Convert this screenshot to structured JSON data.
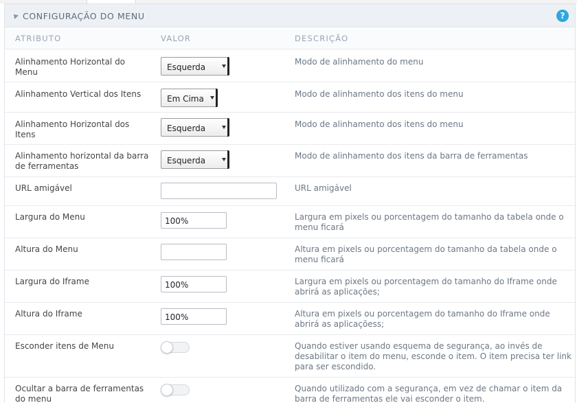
{
  "panel": {
    "title": "CONFIGURAÇÃO DO MENU",
    "help_label": "?"
  },
  "columns": {
    "attribute": "ATRIBUTO",
    "value": "VALOR",
    "description": "DESCRIÇÃO"
  },
  "rows": [
    {
      "attribute": "Alinhamento Horizontal do Menu",
      "value": "Esquerda",
      "description": "Modo de alinhamento do menu"
    },
    {
      "attribute": "Alinhamento Vertical dos Itens",
      "value": "Em Cima",
      "description": "Modo de alinhamento dos itens do menu"
    },
    {
      "attribute": "Alinhamento Horizontal dos Itens",
      "value": "Esquerda",
      "description": "Modo de alinhamento dos itens do menu"
    },
    {
      "attribute": "Alinhamento horizontal da barra de ferramentas",
      "value": "Esquerda",
      "description": "Modo de alinhamento dos itens da barra de ferramentas"
    },
    {
      "attribute": "URL amigável",
      "value": "",
      "description": "URL amigável"
    },
    {
      "attribute": "Largura do Menu",
      "value": "100%",
      "description": "Largura em pixels ou porcentagem do tamanho da tabela onde o menu ficará"
    },
    {
      "attribute": "Altura do Menu",
      "value": "",
      "description": "Altura em pixels ou porcentagem do tamanho da tabela onde o menu ficará"
    },
    {
      "attribute": "Largura do Iframe",
      "value": "100%",
      "description": "Largura em pixels ou porcentagem do tamanho do Iframe onde abrirá as aplicações;"
    },
    {
      "attribute": "Altura do Iframe",
      "value": "100%",
      "description": "Altura em pixels ou porcentagem do tamanho do Iframe onde abrirá as aplicaçõess;"
    },
    {
      "attribute": "Esconder itens de Menu",
      "value": false,
      "description": "Quando estiver usando esquema de segurança, ao invés de desabilitar o item do menu, esconde o item. O item precisa ter link para ser escondido."
    },
    {
      "attribute": "Ocultar a barra de ferramentas do menu",
      "value": false,
      "description": "Quando utilizado com a segurança, em vez de chamar o item da barra de ferramentas ele vai esconder o item."
    }
  ]
}
